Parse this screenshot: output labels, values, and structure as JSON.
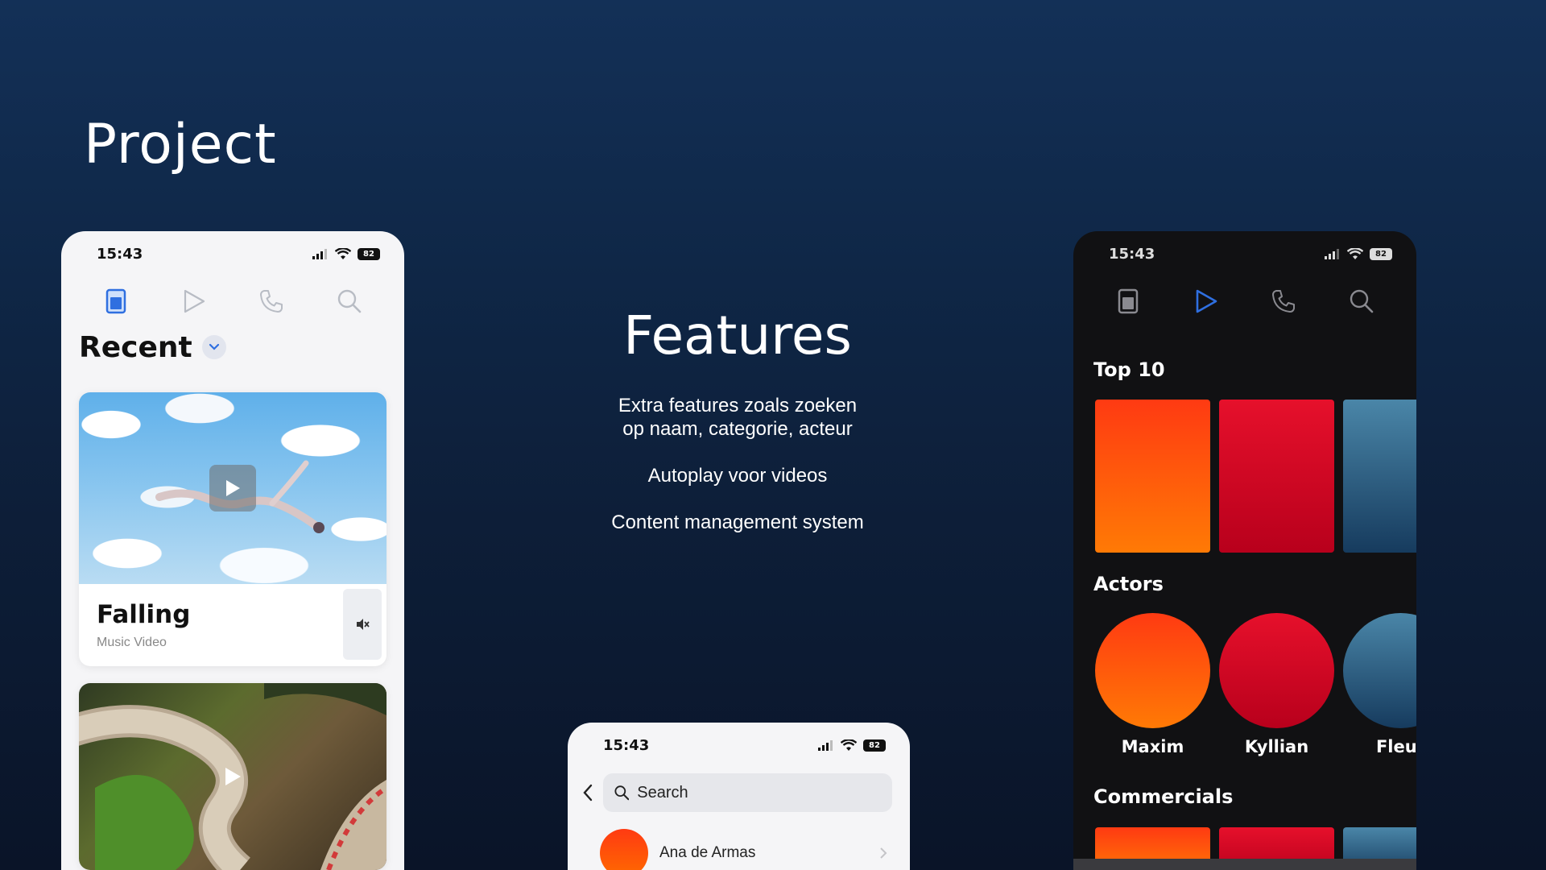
{
  "page": {
    "title": "Project"
  },
  "features": {
    "title": "Features",
    "items": [
      "Extra features zoals zoeken\nop naam, categorie, acteur",
      "Autoplay voor videos",
      "Content management system"
    ]
  },
  "status_bar": {
    "time": "15:43",
    "battery": "82"
  },
  "left_phone": {
    "section_title": "Recent",
    "cards": [
      {
        "title": "Falling",
        "subtitle": "Music Video"
      }
    ]
  },
  "mid_phone": {
    "search_placeholder": "Search",
    "contacts": [
      {
        "name": "Ana de Armas"
      }
    ]
  },
  "right_phone": {
    "top10_title": "Top 10",
    "actors_title": "Actors",
    "commercials_title": "Commercials",
    "actors": [
      {
        "name": "Maxim"
      },
      {
        "name": "Kyllian"
      },
      {
        "name": "Fleur"
      }
    ]
  },
  "colors": {
    "accent_blue": "#2f6fe0",
    "orange": "#ff5a0a",
    "red": "#e0112a",
    "steel_blue": "#2e5d82"
  }
}
